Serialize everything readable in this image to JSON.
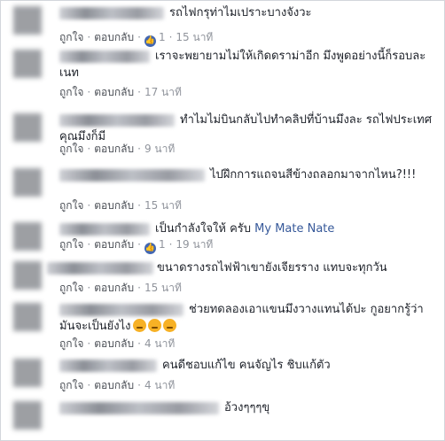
{
  "actions": {
    "like": "ถูกใจ",
    "reply": "ตอบกลับ",
    "separator": "·"
  },
  "comments": [
    {
      "text": "รถไฟกรุท่าไมเปราะบางจังวะ",
      "like_count": "1",
      "time": "15 นาที"
    },
    {
      "text": "เราจะพยายามไม่ให้เกิดดราม่าอีก มึงพูดอย่างนี้ก็รอบละเนท",
      "time": "17 นาที"
    },
    {
      "text": "ทำไมไม่บินกลับไปทำคลิปที่บ้านมึงละ รถไฟประเทศคุณมึงก็มี",
      "time": "9 นาที"
    },
    {
      "text": "ไปฝึกการแถจนสีข้างถลอกมาจากไหน?!!!",
      "time": "15 นาที"
    },
    {
      "text": "เป็นกำลังใจให้ ครับ",
      "mention": "My Mate Nate",
      "like_count": "1",
      "time": "19 นาที"
    },
    {
      "text": "ขนาดรางรถไฟฟ้าเขายังเจียรราง แทบจะทุกวัน",
      "time": "15 นาที"
    },
    {
      "text": "ช่วยทดลองเอาแขนมึงวางแทนได้ปะ กูอยากรู้ว่ามันจะเป็นยังไง",
      "time": "4 นาที"
    },
    {
      "text": "คนดีชอบแก้ไข คนจัญไร ชิบแก้ตัว",
      "time": "4 นาที"
    },
    {
      "text": "อ้วงๆๆๆขุ"
    }
  ],
  "colors": {
    "text": "#1d2129",
    "meta": "#90949c",
    "link": "#365899",
    "like_badge": "#4267b2"
  }
}
